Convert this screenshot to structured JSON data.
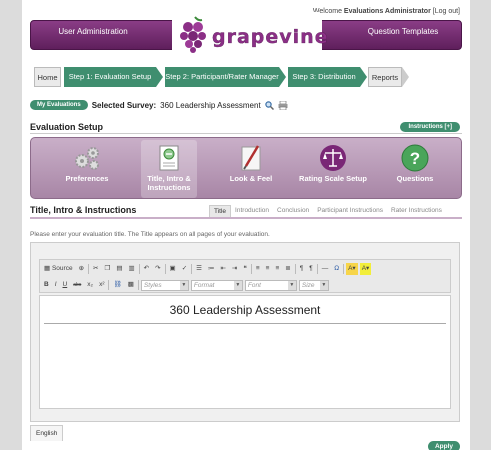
{
  "header": {
    "welcome_prefix": "Welcome",
    "user_name": "Evaluations Administrator",
    "logout_label": "[Log out]",
    "nav_left": "User Administration",
    "nav_right": "Question Templates",
    "logo_text": "grapevine"
  },
  "steps": [
    {
      "label": "Home"
    },
    {
      "label": "Step 1: Evaluation Setup"
    },
    {
      "label": "Step 2: Participant/Rater Manager"
    },
    {
      "label": "Step 3: Distribution"
    },
    {
      "label": "Reports"
    }
  ],
  "survey": {
    "my_evaluations_label": "My Evaluations",
    "selected_label": "Selected Survey:",
    "selected_name": "360 Leadership Assessment"
  },
  "setup": {
    "title": "Evaluation Setup",
    "instructions_button": "Instructions [+]"
  },
  "icons": [
    {
      "label": "Preferences",
      "icon": "gears-icon"
    },
    {
      "label": "Title, Intro & Instructions",
      "icon": "document-icon"
    },
    {
      "label": "Look & Feel",
      "icon": "brush-icon"
    },
    {
      "label": "Rating Scale Setup",
      "icon": "scale-icon"
    },
    {
      "label": "Questions",
      "icon": "question-icon"
    }
  ],
  "section": {
    "title": "Title, Intro & Instructions",
    "tabs": [
      "Title",
      "Introduction",
      "Conclusion",
      "Participant Instructions",
      "Rater Instructions"
    ],
    "hint": "Please enter your evaluation title. The Title appears on all pages of your evaluation."
  },
  "editor": {
    "source_label": "Source",
    "styles_placeholder": "Styles",
    "format_placeholder": "Format",
    "font_placeholder": "Font",
    "size_placeholder": "Size",
    "content_title": "360 Leadership Assessment"
  },
  "footer": {
    "language_tab": "English",
    "apply_button": "Apply"
  },
  "colors": {
    "brand_purple": "#6f2a6b",
    "step_green": "#3f8e6f",
    "panel_lilac": "#b89ab6"
  }
}
